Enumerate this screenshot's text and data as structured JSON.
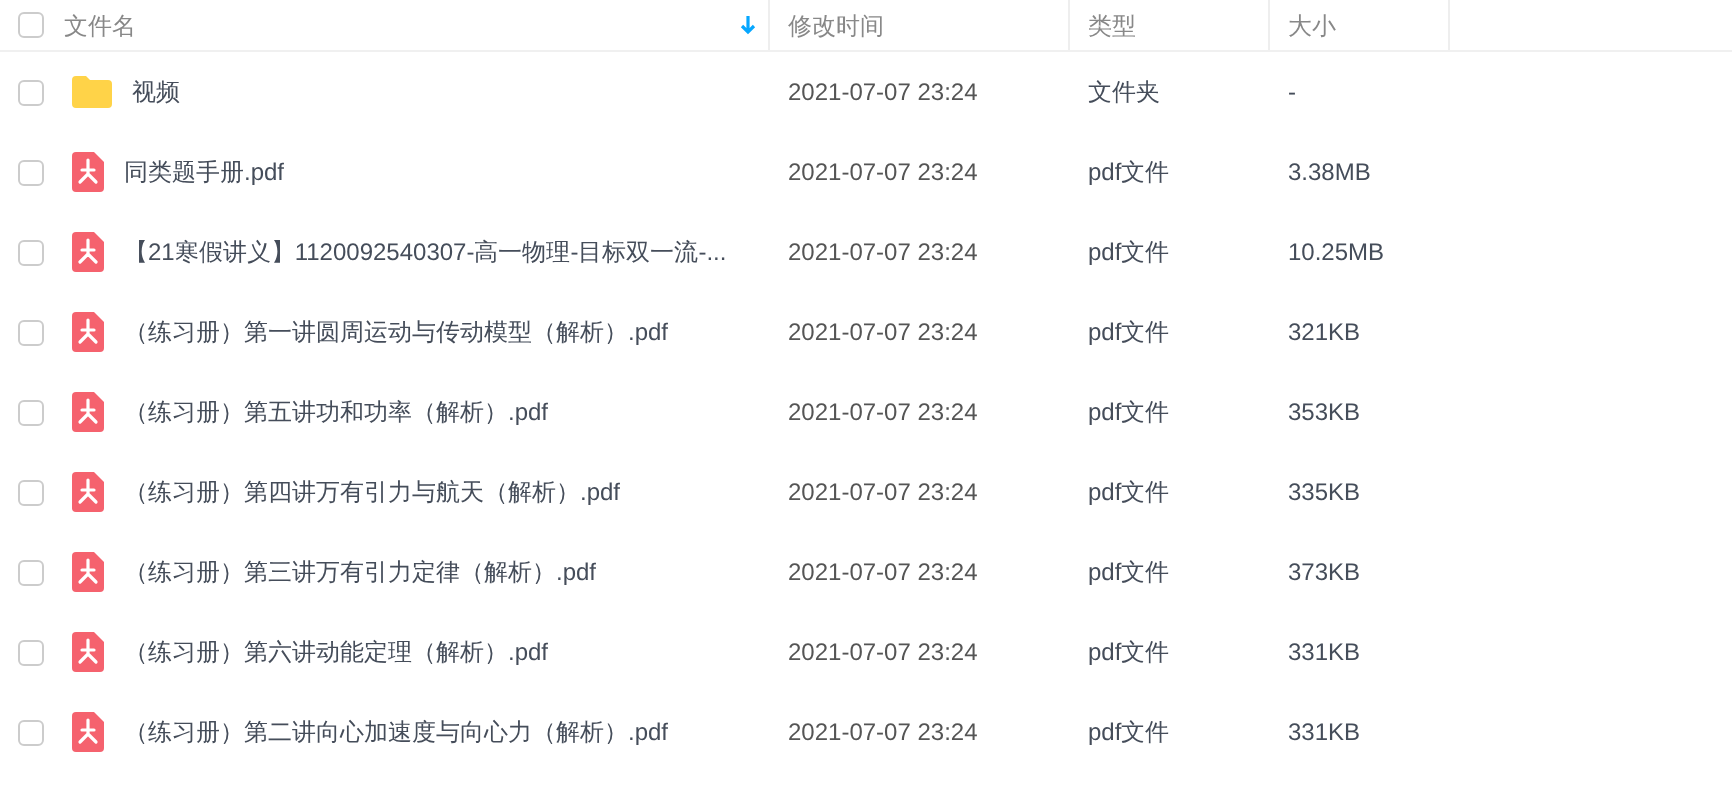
{
  "header": {
    "select_all": {
      "checked": false
    },
    "columns": [
      {
        "label": "文件名",
        "sorted": true
      },
      {
        "label": "修改时间",
        "sorted": false
      },
      {
        "label": "类型",
        "sorted": false
      },
      {
        "label": "大小",
        "sorted": false
      }
    ]
  },
  "rows": [
    {
      "kind": "folder",
      "checked": false,
      "name": "视频",
      "modified": "2021-07-07 23:24",
      "type": "文件夹",
      "size": "-"
    },
    {
      "kind": "pdf",
      "checked": false,
      "name": "同类题手册.pdf",
      "modified": "2021-07-07 23:24",
      "type": "pdf文件",
      "size": "3.38MB"
    },
    {
      "kind": "pdf",
      "checked": false,
      "name": "【21寒假讲义】1120092540307-高一物理-目标双一流-...",
      "modified": "2021-07-07 23:24",
      "type": "pdf文件",
      "size": "10.25MB"
    },
    {
      "kind": "pdf",
      "checked": false,
      "name": "（练习册）第一讲圆周运动与传动模型（解析）.pdf",
      "modified": "2021-07-07 23:24",
      "type": "pdf文件",
      "size": "321KB"
    },
    {
      "kind": "pdf",
      "checked": false,
      "name": "（练习册）第五讲功和功率（解析）.pdf",
      "modified": "2021-07-07 23:24",
      "type": "pdf文件",
      "size": "353KB"
    },
    {
      "kind": "pdf",
      "checked": false,
      "name": "（练习册）第四讲万有引力与航天（解析）.pdf",
      "modified": "2021-07-07 23:24",
      "type": "pdf文件",
      "size": "335KB"
    },
    {
      "kind": "pdf",
      "checked": false,
      "name": "（练习册）第三讲万有引力定律（解析）.pdf",
      "modified": "2021-07-07 23:24",
      "type": "pdf文件",
      "size": "373KB"
    },
    {
      "kind": "pdf",
      "checked": false,
      "name": "（练习册）第六讲动能定理（解析）.pdf",
      "modified": "2021-07-07 23:24",
      "type": "pdf文件",
      "size": "331KB"
    },
    {
      "kind": "pdf",
      "checked": false,
      "name": "（练习册）第二讲向心加速度与向心力（解析）.pdf",
      "modified": "2021-07-07 23:24",
      "type": "pdf文件",
      "size": "331KB"
    }
  ]
}
